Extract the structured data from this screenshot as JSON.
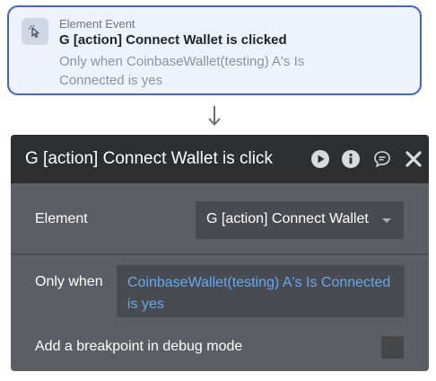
{
  "event": {
    "type_label": "Element Event",
    "title": "G [action] Connect Wallet is clicked",
    "condition": "Only when CoinbaseWallet(testing) A's Is Connected is yes",
    "icon": "cursor-click-icon"
  },
  "panel": {
    "title": "G [action] Connect Wallet is click",
    "buttons": [
      "play-icon",
      "info-icon",
      "comment-icon",
      "close-icon"
    ],
    "element_label": "Element",
    "element_value": "G [action] Connect Wallet",
    "only_when_label": "Only when",
    "only_when_value": "CoinbaseWallet(testing) A's Is Connected is yes",
    "breakpoint_label": "Add a breakpoint in debug mode",
    "breakpoint_checked": false
  },
  "colors": {
    "accent": "#3c63d8",
    "link": "#64a9f2",
    "panel_bg": "#5b5e62",
    "header_bg": "#2c2e30"
  }
}
